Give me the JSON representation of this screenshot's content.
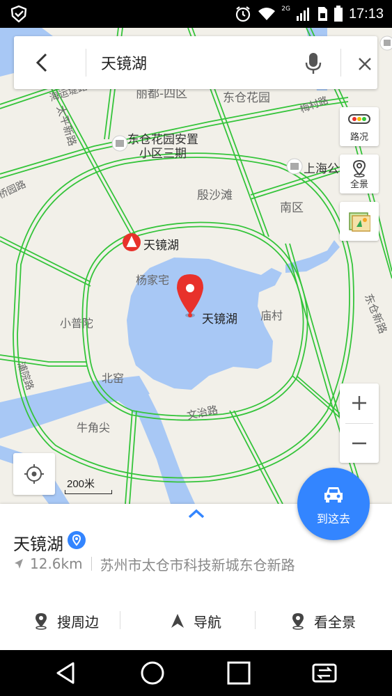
{
  "status_bar": {
    "time": "17:13",
    "network": "2G"
  },
  "search": {
    "query": "天镜湖"
  },
  "map_controls": {
    "traffic_label": "路况",
    "panorama_label": "全景",
    "zoom_in": "+",
    "zoom_out": "−",
    "scale_label": "200米"
  },
  "map_labels": {
    "dongcang_huayuan_1": "东仓花园安置",
    "dongcang_huayuan_2": "小区三期",
    "dongcang_huayuan_top": "东仓花园",
    "liyou_sisqu": "丽都-四区",
    "shanghai": "上海公",
    "yinshatan": "殷沙滩",
    "nanqu": "南区",
    "yangjiazhai": "杨家宅",
    "xiaoputuo": "小普陀",
    "miaocun": "庙村",
    "beirong": "北窑",
    "niujiaojian": "牛角尖",
    "wenzhi_road": "文治路",
    "dongcang_xinlu": "东仓新路",
    "taiping_road": "太平新路",
    "haiyun_road": "海运堤路",
    "meicun_road": "梅村路",
    "huaqiao_road": "桥园路",
    "pu_road": "浦院路",
    "poi_scenic": "天镜湖",
    "poi_marker": "天镜湖"
  },
  "poi": {
    "name": "天镜湖",
    "distance": "12.6km",
    "address": "苏州市太仓市科技新城东仓新路"
  },
  "actions": {
    "go_label": "到这去",
    "nearby": "搜周边",
    "navigate": "导航",
    "panorama": "看全景"
  },
  "colors": {
    "accent": "#3385ff",
    "road_green": "#34c43a",
    "water": "#a8c8f5",
    "marker_red": "#e8312b"
  }
}
